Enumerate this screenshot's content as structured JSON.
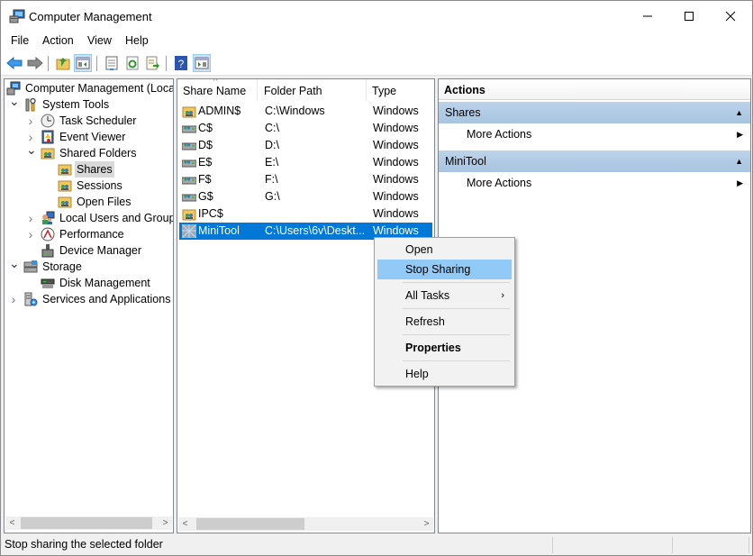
{
  "window": {
    "title": "Computer Management",
    "controls": {
      "minimize": "minimize",
      "maximize": "maximize",
      "close": "close"
    }
  },
  "menubar": [
    "File",
    "Action",
    "View",
    "Help"
  ],
  "toolbar": {
    "buttons": [
      "back",
      "forward",
      "up-one-level",
      "show-hide-console-tree",
      "properties",
      "refresh",
      "export-list",
      "help",
      "show-hide-action-pane"
    ]
  },
  "tree": {
    "items": [
      {
        "label": "Computer Management (Local",
        "icon": "computer-management-icon",
        "depth": 0,
        "expander": ""
      },
      {
        "label": "System Tools",
        "icon": "tools-icon",
        "depth": 1,
        "expander": "expanded"
      },
      {
        "label": "Task Scheduler",
        "icon": "clock-icon",
        "depth": 2,
        "expander": "collapsed"
      },
      {
        "label": "Event Viewer",
        "icon": "event-viewer-icon",
        "depth": 2,
        "expander": "collapsed"
      },
      {
        "label": "Shared Folders",
        "icon": "shared-folder-icon",
        "depth": 2,
        "expander": "expanded"
      },
      {
        "label": "Shares",
        "icon": "shared-folder-icon",
        "depth": 3,
        "expander": "",
        "selected": true
      },
      {
        "label": "Sessions",
        "icon": "shared-folder-icon",
        "depth": 3,
        "expander": ""
      },
      {
        "label": "Open Files",
        "icon": "shared-folder-icon",
        "depth": 3,
        "expander": ""
      },
      {
        "label": "Local Users and Groups",
        "icon": "users-icon",
        "depth": 2,
        "expander": "collapsed"
      },
      {
        "label": "Performance",
        "icon": "performance-icon",
        "depth": 2,
        "expander": "collapsed"
      },
      {
        "label": "Device Manager",
        "icon": "device-manager-icon",
        "depth": 2,
        "expander": ""
      },
      {
        "label": "Storage",
        "icon": "storage-icon",
        "depth": 1,
        "expander": "expanded"
      },
      {
        "label": "Disk Management",
        "icon": "disk-icon",
        "depth": 2,
        "expander": ""
      },
      {
        "label": "Services and Applications",
        "icon": "services-icon",
        "depth": 1,
        "expander": "collapsed"
      }
    ]
  },
  "list": {
    "columns": [
      "Share Name",
      "Folder Path",
      "Type"
    ],
    "sort_indicator": "^",
    "rows": [
      {
        "name": "ADMIN$",
        "path": "C:\\Windows",
        "type": "Windows",
        "icon": "shared-folder-icon"
      },
      {
        "name": "C$",
        "path": "C:\\",
        "type": "Windows",
        "icon": "shared-drive-icon"
      },
      {
        "name": "D$",
        "path": "D:\\",
        "type": "Windows",
        "icon": "shared-drive-icon"
      },
      {
        "name": "E$",
        "path": "E:\\",
        "type": "Windows",
        "icon": "shared-drive-icon"
      },
      {
        "name": "F$",
        "path": "F:\\",
        "type": "Windows",
        "icon": "shared-drive-icon"
      },
      {
        "name": "G$",
        "path": "G:\\",
        "type": "Windows",
        "icon": "shared-drive-icon"
      },
      {
        "name": "IPC$",
        "path": "",
        "type": "Windows",
        "icon": "shared-folder-icon"
      },
      {
        "name": "MiniTool",
        "path": "C:\\Users\\6v\\Deskt...",
        "type": "Windows",
        "icon": "shared-folder-icon",
        "selected": true
      }
    ]
  },
  "context_menu": {
    "items": [
      {
        "label": "Open"
      },
      {
        "label": "Stop Sharing",
        "highlighted": true
      },
      {
        "label": "All Tasks",
        "submenu": "›"
      },
      {
        "label": "Refresh"
      },
      {
        "label": "Properties",
        "bold": true
      },
      {
        "label": "Help"
      }
    ]
  },
  "actions": {
    "title": "Actions",
    "groups": [
      {
        "label": "Shares",
        "items": [
          "More Actions"
        ]
      },
      {
        "label": "MiniTool",
        "items": [
          "More Actions"
        ]
      }
    ]
  },
  "statusbar": {
    "text": "Stop sharing the selected folder"
  },
  "colors": {
    "selection": "#0078d7",
    "menu_highlight": "#91c9f7",
    "action_group": "#b4cde6"
  }
}
